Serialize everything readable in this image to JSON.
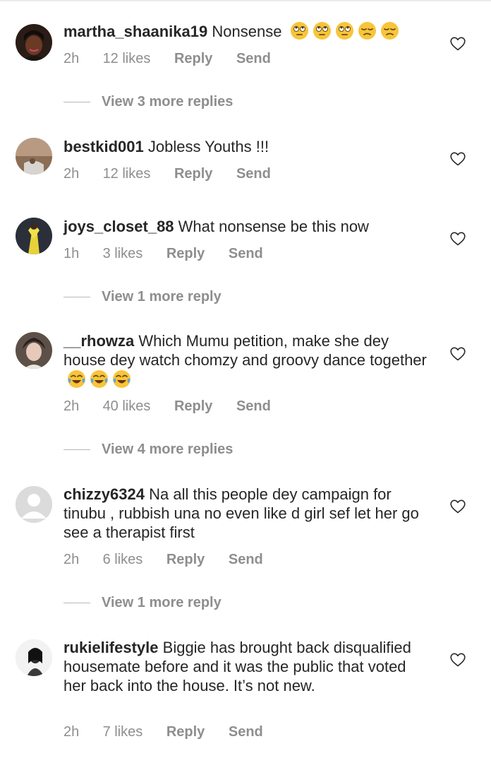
{
  "comments": [
    {
      "username": "martha_shaanika19",
      "text": "Nonsense",
      "emojis": [
        "eye-roll-emoji",
        "eye-roll-emoji",
        "eye-roll-emoji",
        "unamused-emoji",
        "unamused-emoji"
      ],
      "time": "2h",
      "likes": "12 likes",
      "reply": "Reply",
      "send": "Send",
      "view_more": "View 3 more replies"
    },
    {
      "username": "bestkid001",
      "text": "Jobless Youths !!!",
      "time": "2h",
      "likes": "12 likes",
      "reply": "Reply",
      "send": "Send"
    },
    {
      "username": "joys_closet_88",
      "text": "What nonsense be this now",
      "time": "1h",
      "likes": "3 likes",
      "reply": "Reply",
      "send": "Send",
      "view_more": "View 1 more reply"
    },
    {
      "username": "__rhowza",
      "text": "Which Mumu petition, make she dey house dey watch chomzy and groovy dance together",
      "emojis": [
        "tears-of-joy-emoji",
        "tears-of-joy-emoji",
        "tears-of-joy-emoji"
      ],
      "time": "2h",
      "likes": "40 likes",
      "reply": "Reply",
      "send": "Send",
      "view_more": "View 4 more replies"
    },
    {
      "username": "chizzy6324",
      "text": "Na all this people dey campaign for tinubu , rubbish una no even like d girl sef let her go see a therapist first",
      "time": "2h",
      "likes": "6 likes",
      "reply": "Reply",
      "send": "Send",
      "view_more": "View 1 more reply"
    },
    {
      "username": "rukielifestyle",
      "text": "Biggie has brought back disqualified housemate before and it was the public that voted her back into the house. It’s not new.",
      "time": "2h",
      "likes": "7 likes",
      "reply": "Reply",
      "send": "Send"
    }
  ],
  "icons": {
    "like": "heart-outline-icon",
    "default_avatar": "default-avatar-icon"
  },
  "colors": {
    "text": "#262626",
    "muted": "#8e8e8e",
    "divider": "#b8b8b8"
  }
}
